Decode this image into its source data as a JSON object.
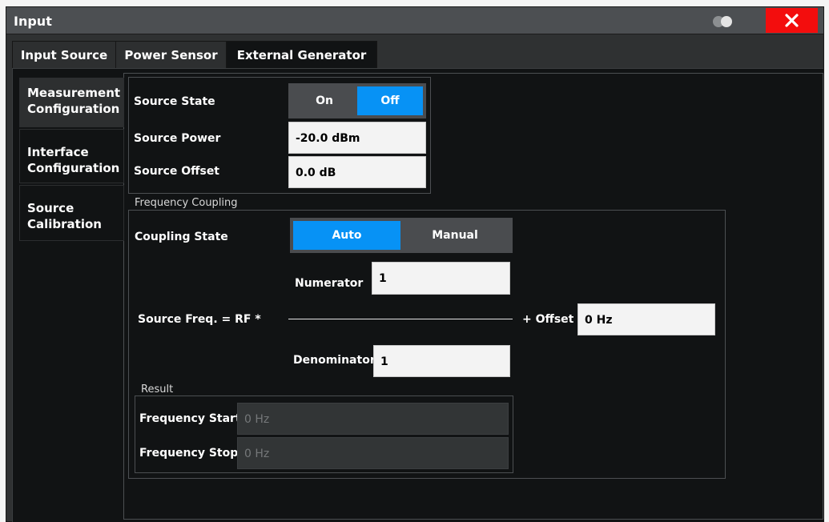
{
  "window": {
    "title": "Input"
  },
  "tabs": [
    "Input Source",
    "Power Sensor",
    "External Generator"
  ],
  "side_tabs": [
    "Measurement Configuration",
    "Interface Configuration",
    "Source Calibration"
  ],
  "source": {
    "state_label": "Source State",
    "state_options": [
      "On",
      "Off"
    ],
    "state_selected": "Off",
    "power_label": "Source Power",
    "power_value": "-20.0 dBm",
    "offset_label": "Source Offset",
    "offset_value": "0.0 dB"
  },
  "frequency_coupling": {
    "caption": "Frequency Coupling",
    "coupling_label": "Coupling State",
    "coupling_options": [
      "Auto",
      "Manual"
    ],
    "coupling_selected": "Auto",
    "numerator_label": "Numerator",
    "numerator_value": "1",
    "formula_label": "Source Freq. = RF *",
    "offset_label": "+ Offset",
    "offset_value": "0 Hz",
    "denominator_label": "Denominator",
    "denominator_value": "1"
  },
  "result": {
    "caption": "Result",
    "freq_start_label": "Frequency Start",
    "freq_start_value": "0 Hz",
    "freq_stop_label": "Frequency Stop",
    "freq_stop_value": "0 Hz"
  },
  "colors": {
    "accent": "#0792f5",
    "close": "#f30d0d"
  },
  "icons": [
    "toggle-icon",
    "close-icon"
  ]
}
